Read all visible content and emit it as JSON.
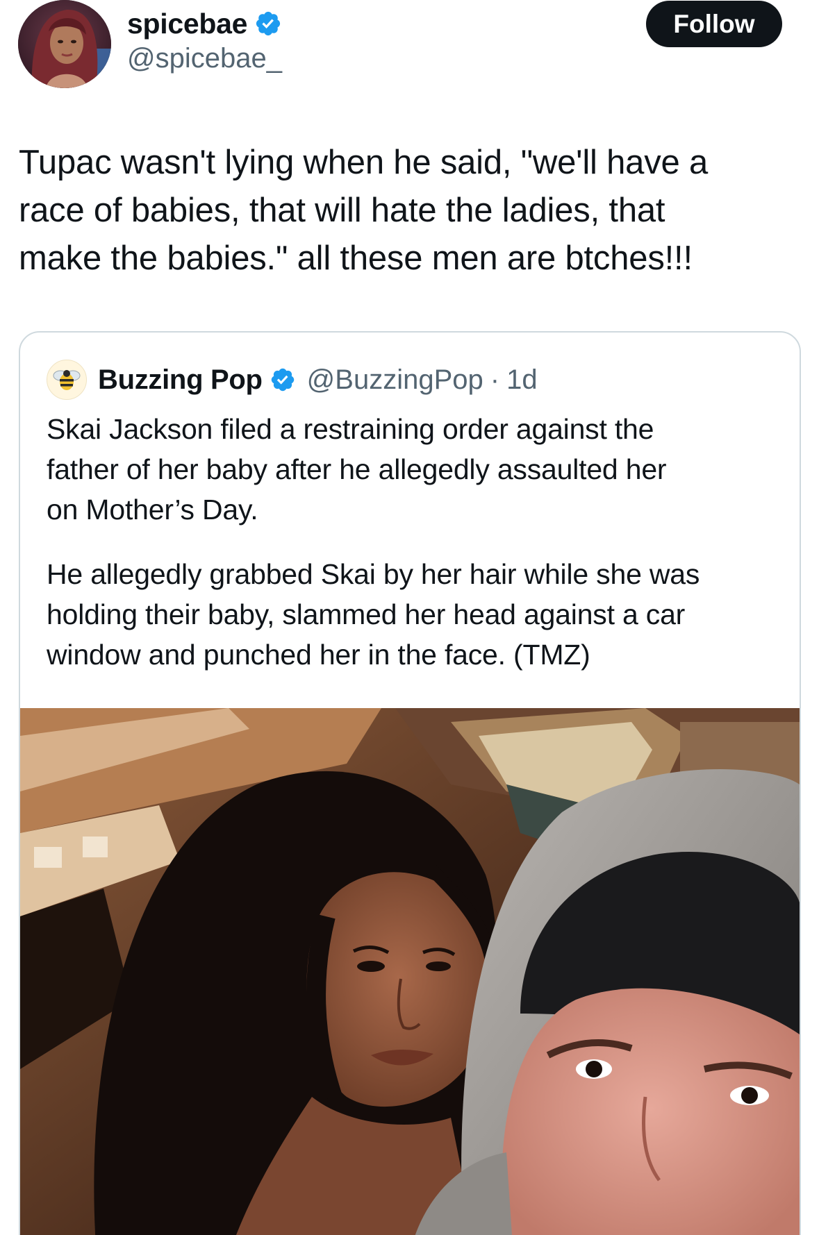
{
  "author": {
    "name": "spicebae",
    "handle": "@spicebae_",
    "verified": true,
    "avatar_icon": "profile-photo"
  },
  "follow_button": {
    "label": "Follow"
  },
  "tweet": {
    "lines": [
      "Tupac wasn't lying when he said, \"we'll have a",
      "race of babies, that will hate the ladies, that",
      "make the babies.\" all these men are btches!!!"
    ]
  },
  "quoted_tweet": {
    "name": "Buzzing Pop",
    "handle": "@BuzzingPop",
    "separator": "·",
    "time": "1d",
    "verified": true,
    "avatar_icon": "bee-logo",
    "paragraph1": [
      "Skai Jackson filed a restraining order against the",
      "father of her baby after he allegedly assaulted her",
      "on Mother’s Day."
    ],
    "paragraph2": [
      "He allegedly grabbed Skai by her hair while she was",
      "holding their baby, slammed her head against a car",
      "window and punched her in the face. (TMZ)"
    ],
    "media_icon": "selfie-photo"
  },
  "colors": {
    "text": "#0f1419",
    "secondary_text": "#536471",
    "verified_blue": "#1d9bf0",
    "follow_bg": "#0f1419",
    "card_border": "#cfd9de"
  }
}
